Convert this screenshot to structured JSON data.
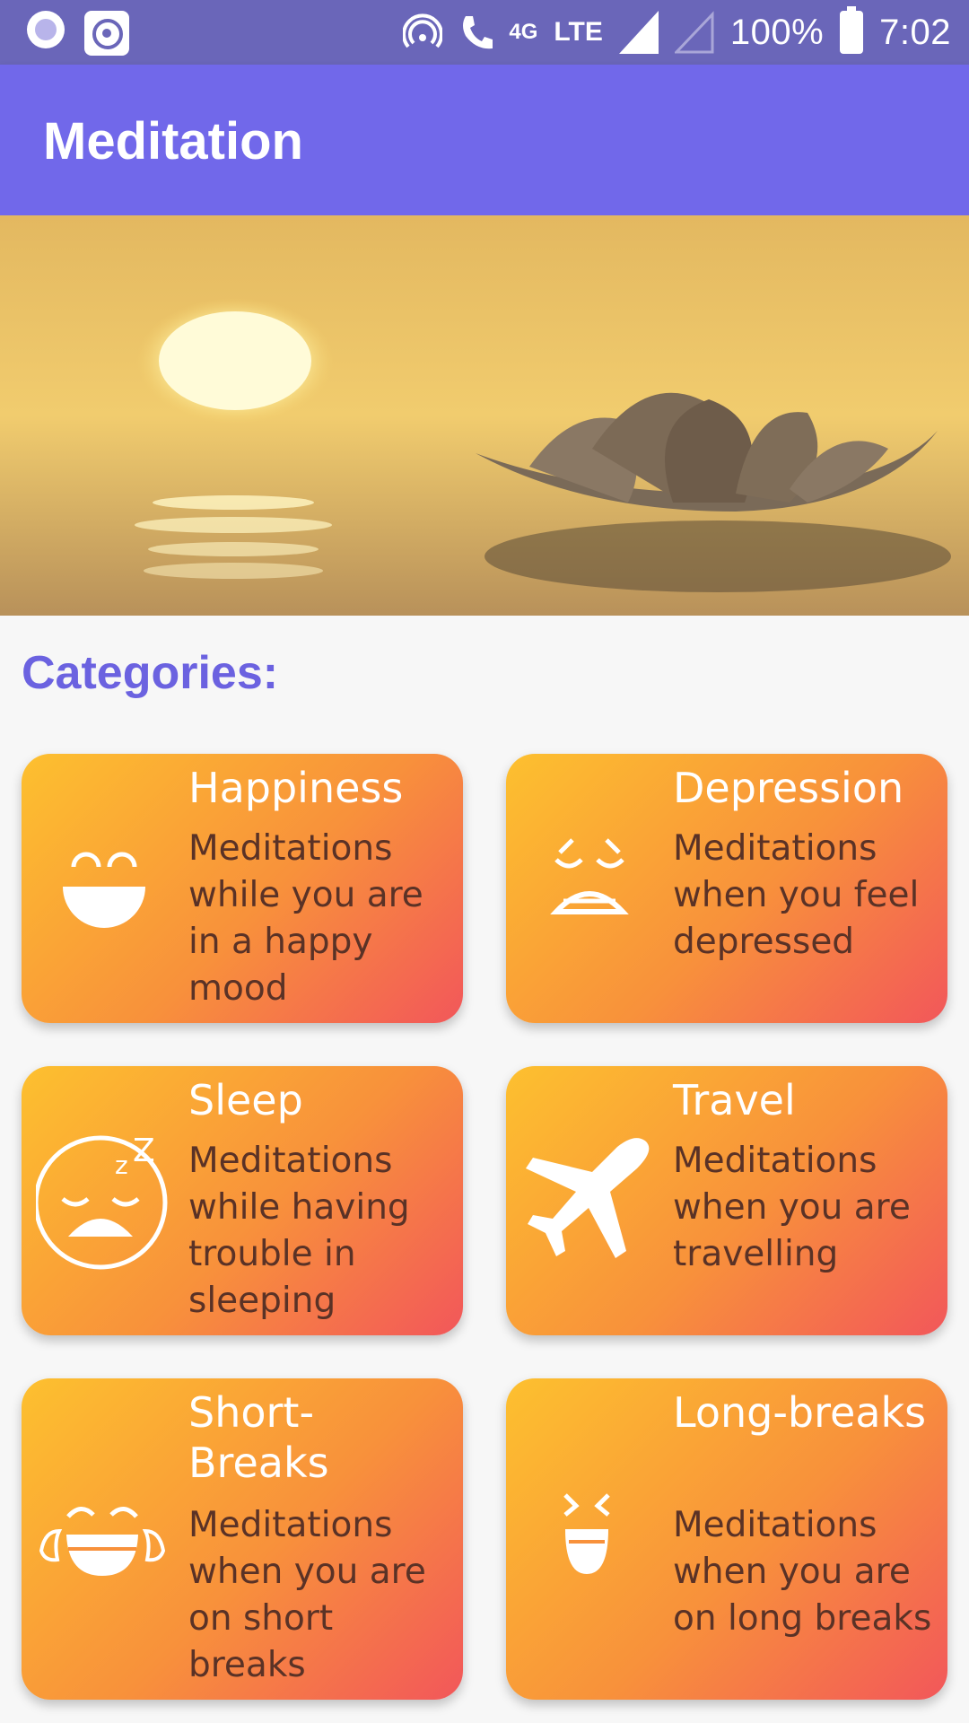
{
  "status_bar": {
    "network_small": "4G",
    "network": "LTE",
    "battery": "100%",
    "time": "7:02"
  },
  "app_bar": {
    "title": "Meditation"
  },
  "section": {
    "heading": "Categories:"
  },
  "categories": [
    {
      "title": "Happiness",
      "description": "Meditations while you are in a happy mood",
      "icon": "smile-icon"
    },
    {
      "title": "Depression",
      "description": "Meditations when you feel depressed",
      "icon": "sad-face-icon"
    },
    {
      "title": "Sleep",
      "description": "Meditations while having trouble in sleeping",
      "icon": "sleeping-face-icon"
    },
    {
      "title": "Travel",
      "description": "Meditations when you are travelling",
      "icon": "airplane-icon"
    },
    {
      "title": "Short-Breaks",
      "description": "Meditations when you are on short breaks",
      "icon": "laughing-tears-icon"
    },
    {
      "title": "Long-breaks",
      "description": "Meditations when you are on long breaks",
      "icon": "grin-icon"
    }
  ],
  "colors": {
    "status_bar": "#6a66b9",
    "app_bar": "#7168ea",
    "heading": "#6b62e0",
    "card_gradient_start": "#fdc02f",
    "card_gradient_end": "#f2575a"
  }
}
